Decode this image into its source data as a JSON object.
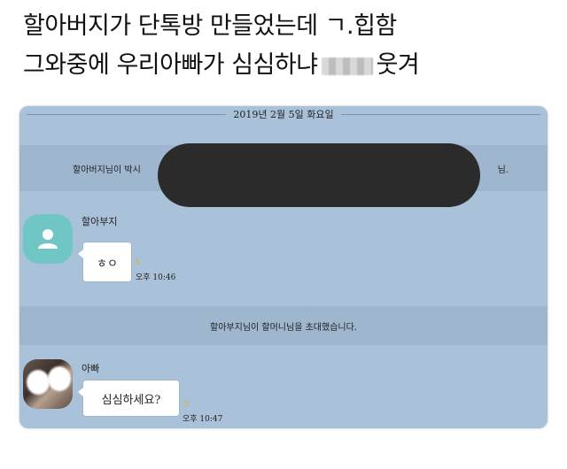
{
  "caption": {
    "line1": "할아버지가 단톡방 만들었는데 ㄱ.힙함",
    "line2_before": "그와중에 우리아빠가 심심하냐",
    "line2_after": "웃겨"
  },
  "chat": {
    "date": "2019년 2월 5일 화요일",
    "system_1_left": "할아버지님이 박시",
    "system_1_right": "님.",
    "system_2": "할아부지님이 할머니님을 초대했습니다.",
    "messages": [
      {
        "sender": "할아부지",
        "text": "ㅎㅇ",
        "time": "오후 10:46",
        "unread": "5"
      },
      {
        "sender": "아빠",
        "text": "심심하세요?",
        "time": "오후 10:47",
        "unread": "5"
      }
    ]
  },
  "colors": {
    "chat_background": "#a9c1d9",
    "system_band": "#9fb6cf",
    "default_avatar": "#6fc6c4",
    "unread_count": "#e3b600"
  }
}
